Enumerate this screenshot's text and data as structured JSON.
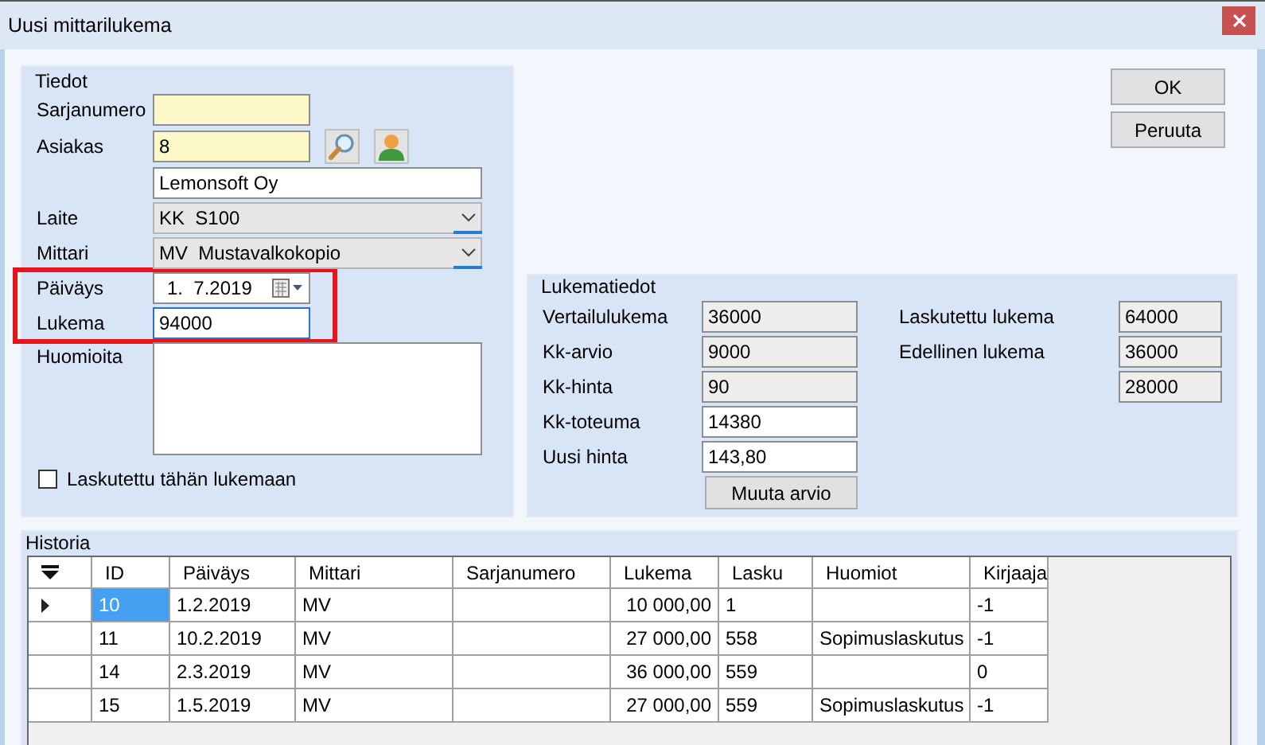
{
  "window": {
    "title": "Uusi mittarilukema"
  },
  "tiedot": {
    "title": "Tiedot",
    "fields": [
      {
        "kind": "text",
        "label": "Sarjanumero",
        "required": true
      },
      {
        "kind": "lookup",
        "label": "Asiakas",
        "value": "8",
        "required": true
      },
      {
        "kind": "line",
        "value": "Lemonsoft Oy",
        "required": false
      },
      {
        "kind": "combo",
        "label": "Laite",
        "value": "KK  S100"
      },
      {
        "kind": "combo",
        "label": "Mittari",
        "value": "MV  Mustavalkokopio"
      },
      {
        "kind": "date",
        "label": "Päiväys",
        "value": "1.  7.2019",
        "highlighted": true
      },
      {
        "kind": "text",
        "label": "Lukema",
        "value": "94000",
        "required": false,
        "focused": true,
        "highlighted": true
      },
      {
        "kind": "memo",
        "label": "Huomioita"
      }
    ],
    "checkbox": {
      "label": "Laskutettu tähän lukemaan",
      "checked": false
    }
  },
  "buttons": [
    "OK",
    "Peruuta"
  ],
  "lukematiedot": {
    "title": "Lukematiedot",
    "left": [
      {
        "label": "Vertailulukema",
        "value": "36000",
        "readonly": true
      },
      {
        "label": "Kk-arvio",
        "value": "9000",
        "readonly": true
      },
      {
        "label": "Kk-hinta",
        "value": "90",
        "readonly": true
      },
      {
        "label": "Kk-toteuma",
        "value": "14380",
        "readonly": false
      },
      {
        "label": "Uusi hinta",
        "value": "143,80",
        "readonly": false
      }
    ],
    "right": [
      {
        "label": "Laskutettu lukema",
        "value": "64000",
        "readonly": true
      },
      {
        "label": "Edellinen lukema",
        "value": "36000",
        "readonly": true
      },
      {
        "value": "28000",
        "readonly": true
      }
    ],
    "button": "Muuta arvio"
  },
  "historia": {
    "title": "Historia",
    "columns": [
      {
        "label": "ID",
        "kind": "text"
      },
      {
        "label": "Päiväys",
        "kind": "text"
      },
      {
        "label": "Mittari",
        "kind": "text"
      },
      {
        "label": "Sarjanumero",
        "kind": "text"
      },
      {
        "label": "Lukema",
        "kind": "number"
      },
      {
        "label": "Lasku",
        "kind": "text"
      },
      {
        "label": "Huomiot",
        "kind": "text"
      },
      {
        "label": "Kirjaaja",
        "kind": "text"
      }
    ],
    "rows": [
      {
        "selected": true,
        "cells": [
          "10",
          "1.2.2019",
          "MV",
          null,
          "10 000,00",
          "1",
          null,
          "-1"
        ]
      },
      {
        "selected": false,
        "cells": [
          "11",
          "10.2.2019",
          "MV",
          null,
          "27 000,00",
          "558",
          "Sopimuslaskutus",
          "-1"
        ]
      },
      {
        "selected": false,
        "cells": [
          "14",
          "2.3.2019",
          "MV",
          null,
          "36 000,00",
          "559",
          null,
          "0"
        ]
      },
      {
        "selected": false,
        "cells": [
          "15",
          "1.5.2019",
          "MV",
          null,
          "27 000,00",
          "559",
          "Sopimuslaskutus",
          "-1"
        ]
      }
    ]
  }
}
